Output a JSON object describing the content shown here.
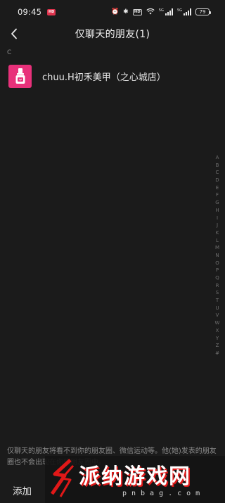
{
  "status_bar": {
    "time": "09:45",
    "battery": "79",
    "hd_label": "HD",
    "signal1_label": "5G",
    "signal2_label": "5G"
  },
  "header": {
    "title": "仅聊天的朋友(1)"
  },
  "list": {
    "sections": [
      {
        "letter": "C",
        "contacts": [
          {
            "name": "chuu.H初禾美甲（之心城店）",
            "avatar_color": "#e8317a"
          }
        ]
      }
    ]
  },
  "alphabet_index": [
    "A",
    "B",
    "C",
    "D",
    "E",
    "F",
    "G",
    "H",
    "I",
    "J",
    "K",
    "L",
    "M",
    "N",
    "O",
    "P",
    "Q",
    "R",
    "S",
    "T",
    "U",
    "V",
    "W",
    "X",
    "Y",
    "Z",
    "#"
  ],
  "footer": {
    "note": "仅聊天的朋友将看不到你的朋友圈、微信运动等。他(她)发表的朋友圈也不会出现在你的朋友圈中。",
    "add_label": "添加"
  },
  "watermark": {
    "title": "派纳游戏网",
    "url": "pnbag.com"
  },
  "colors": {
    "background": "#1b1b1b",
    "avatar_bg": "#e8317a",
    "watermark_accent": "#e01818"
  }
}
